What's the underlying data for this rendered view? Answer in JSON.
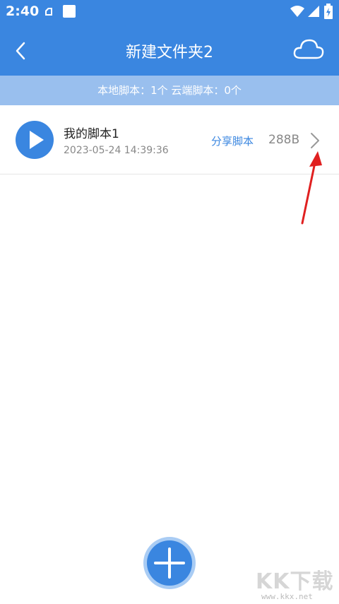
{
  "status_bar": {
    "time": "2:40"
  },
  "header": {
    "title": "新建文件夹2"
  },
  "summary": {
    "text": "本地脚本：1个 云端脚本：0个"
  },
  "scripts": [
    {
      "name": "我的脚本1",
      "date": "2023-05-24 14:39:36",
      "share_label": "分享脚本",
      "size": "288B"
    }
  ],
  "watermark": {
    "text": "KK下载",
    "subtext": "www.kkx.net"
  },
  "colors": {
    "primary": "#3a86e0",
    "summary_bar": "#99bfee",
    "annotation_arrow": "#e02020"
  }
}
